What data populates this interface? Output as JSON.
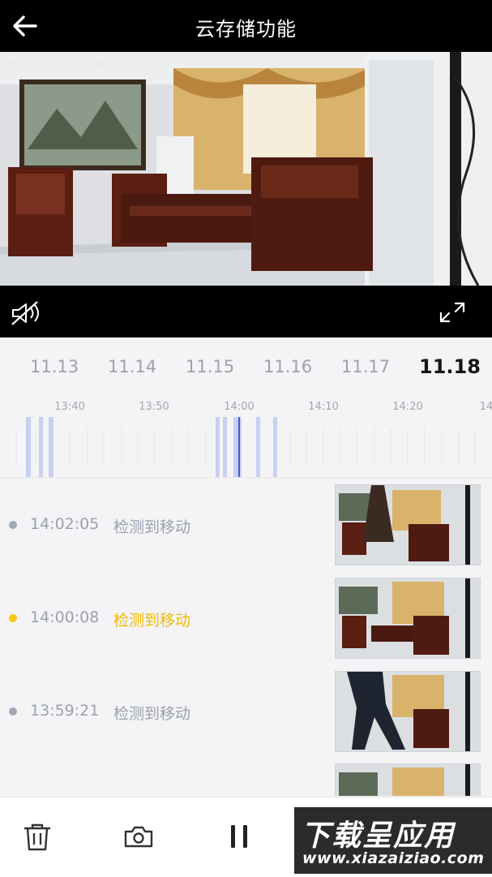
{
  "header": {
    "title": "云存储功能",
    "back_icon": "arrow-left-icon"
  },
  "player": {
    "timestamp": "2021-11-18 14:00:07",
    "mute_icon": "speaker-muted-icon",
    "fullscreen_icon": "fullscreen-icon"
  },
  "dates": [
    {
      "label": "11.13",
      "selected": false
    },
    {
      "label": "11.14",
      "selected": false
    },
    {
      "label": "11.15",
      "selected": false
    },
    {
      "label": "11.16",
      "selected": false
    },
    {
      "label": "11.17",
      "selected": false
    },
    {
      "label": "11.18",
      "selected": true
    }
  ],
  "timeline": {
    "labels": [
      "13:40",
      "13:50",
      "14:00",
      "14:10",
      "14:20",
      "14"
    ],
    "current_time": "14:00",
    "accent_color": "#3b5bd6"
  },
  "events": [
    {
      "time": "14:02:05",
      "label": "检测到移动",
      "selected": false
    },
    {
      "time": "14:00:08",
      "label": "检测到移动",
      "selected": true
    },
    {
      "time": "13:59:21",
      "label": "检测到移动",
      "selected": false
    },
    {
      "time": "",
      "label": "",
      "selected": false
    }
  ],
  "colors": {
    "selected": "#f5b800",
    "muted_text": "#9aa1ae",
    "header_bg": "#000000"
  },
  "bottom_bar": {
    "delete_icon": "trash-icon",
    "snapshot_icon": "camera-icon",
    "pause_icon": "pause-icon"
  },
  "watermark": {
    "title": "下载呈应用",
    "url": "www.xiazaiziao.com"
  }
}
